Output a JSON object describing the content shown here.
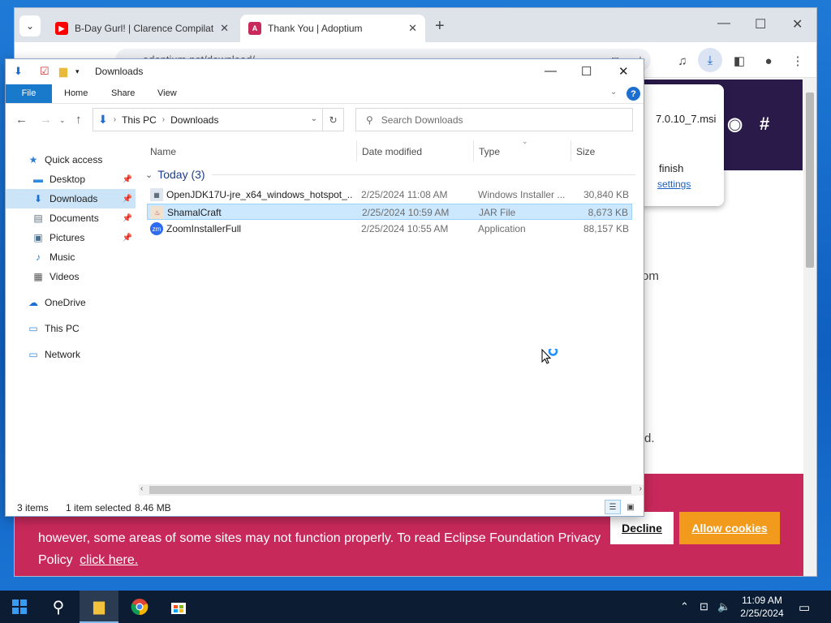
{
  "browser": {
    "tabs": [
      {
        "title": "B-Day Gurl! | Clarence Compilat"
      },
      {
        "title": "Thank You | Adoptium"
      }
    ],
    "address": "adoptium.net/download/",
    "download_popup": {
      "filename": "7.0.10_7.msi",
      "status": "finish",
      "link": "settings"
    },
    "page_fragments": {
      "right1": "om",
      "right2": "d."
    },
    "cookie": {
      "text": "however, some areas of some sites may not function properly. To read Eclipse Foundation Privacy Policy",
      "link": "click here.",
      "decline": "Decline",
      "allow": "Allow cookies"
    },
    "colors": {
      "cookie_bg": "#c8295b",
      "allow_bg": "#f29a1c",
      "accent": "#1979ca"
    }
  },
  "explorer": {
    "title": "Downloads",
    "ribbon_tabs": [
      "File",
      "Home",
      "Share",
      "View"
    ],
    "breadcrumb": [
      "This PC",
      "Downloads"
    ],
    "search_placeholder": "Search Downloads",
    "nav": [
      {
        "label": "Quick access",
        "icon": "star-icon"
      },
      {
        "label": "Desktop",
        "icon": "desktop-icon",
        "pinned": true
      },
      {
        "label": "Downloads",
        "icon": "download-icon",
        "pinned": true,
        "selected": true
      },
      {
        "label": "Documents",
        "icon": "document-icon",
        "pinned": true
      },
      {
        "label": "Pictures",
        "icon": "picture-icon",
        "pinned": true
      },
      {
        "label": "Music",
        "icon": "music-icon"
      },
      {
        "label": "Videos",
        "icon": "video-icon"
      },
      {
        "label": "OneDrive",
        "icon": "cloud-icon"
      },
      {
        "label": "This PC",
        "icon": "computer-icon"
      },
      {
        "label": "Network",
        "icon": "network-icon"
      }
    ],
    "columns": [
      "Name",
      "Date modified",
      "Type",
      "Size"
    ],
    "group": "Today (3)",
    "files": [
      {
        "name": "OpenJDK17U-jre_x64_windows_hotspot_...",
        "date": "2/25/2024 11:08 AM",
        "type": "Windows Installer ...",
        "size": "30,840 KB",
        "icon": "msi-icon"
      },
      {
        "name": "ShamalCraft",
        "date": "2/25/2024 10:59 AM",
        "type": "JAR File",
        "size": "8,673 KB",
        "icon": "jar-icon",
        "selected": true
      },
      {
        "name": "ZoomInstallerFull",
        "date": "2/25/2024 10:55 AM",
        "type": "Application",
        "size": "88,157 KB",
        "icon": "zoom-icon"
      }
    ],
    "status": {
      "items": "3 items",
      "selected": "1 item selected",
      "size": "8.46 MB"
    }
  },
  "taskbar": {
    "time": "11:09 AM",
    "date": "2/25/2024"
  }
}
